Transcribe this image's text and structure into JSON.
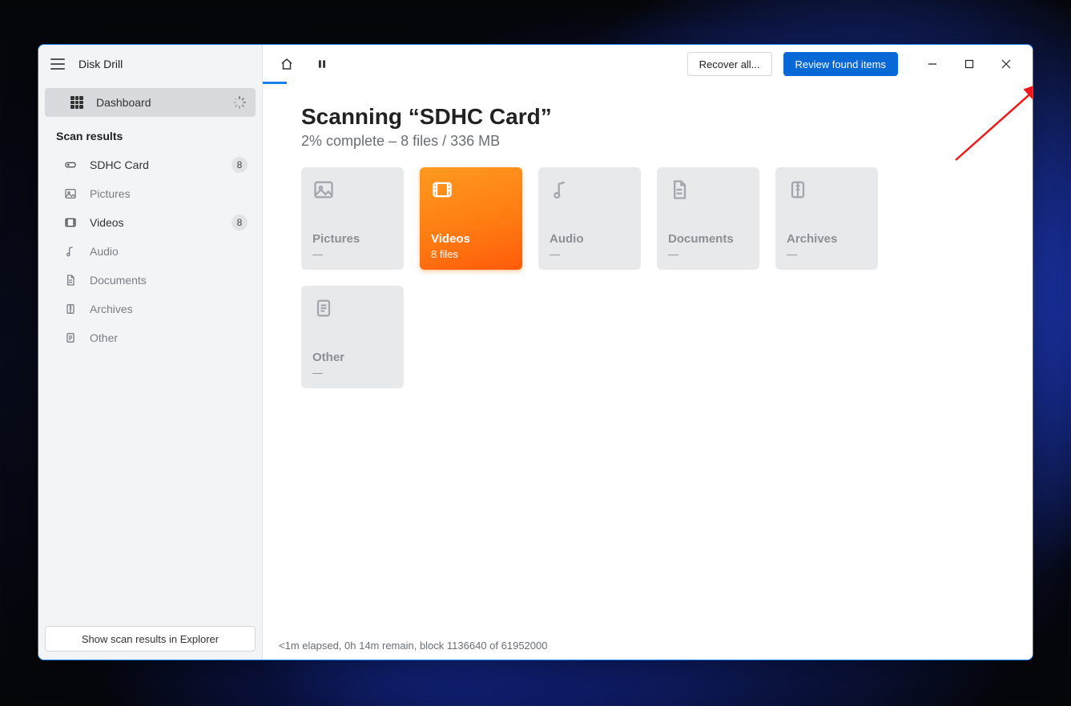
{
  "app": {
    "title": "Disk Drill"
  },
  "sidebar": {
    "dashboard_label": "Dashboard",
    "section_label": "Scan results",
    "items": [
      {
        "label": "SDHC Card",
        "badge": "8"
      },
      {
        "label": "Pictures"
      },
      {
        "label": "Videos",
        "badge": "8"
      },
      {
        "label": "Audio"
      },
      {
        "label": "Documents"
      },
      {
        "label": "Archives"
      },
      {
        "label": "Other"
      }
    ],
    "footer_button": "Show scan results in Explorer"
  },
  "topbar": {
    "recover_label": "Recover all...",
    "review_label": "Review found items"
  },
  "scan": {
    "title": "Scanning “SDHC Card”",
    "subtitle": "2% complete – 8 files / 336 MB",
    "status": "<1m elapsed, 0h 14m remain, block 1136640 of 61952000"
  },
  "cards": [
    {
      "title": "Pictures",
      "sub": "—"
    },
    {
      "title": "Videos",
      "sub": "8 files",
      "active": true
    },
    {
      "title": "Audio",
      "sub": "—"
    },
    {
      "title": "Documents",
      "sub": "—"
    },
    {
      "title": "Archives",
      "sub": "—"
    },
    {
      "title": "Other",
      "sub": "—"
    }
  ]
}
